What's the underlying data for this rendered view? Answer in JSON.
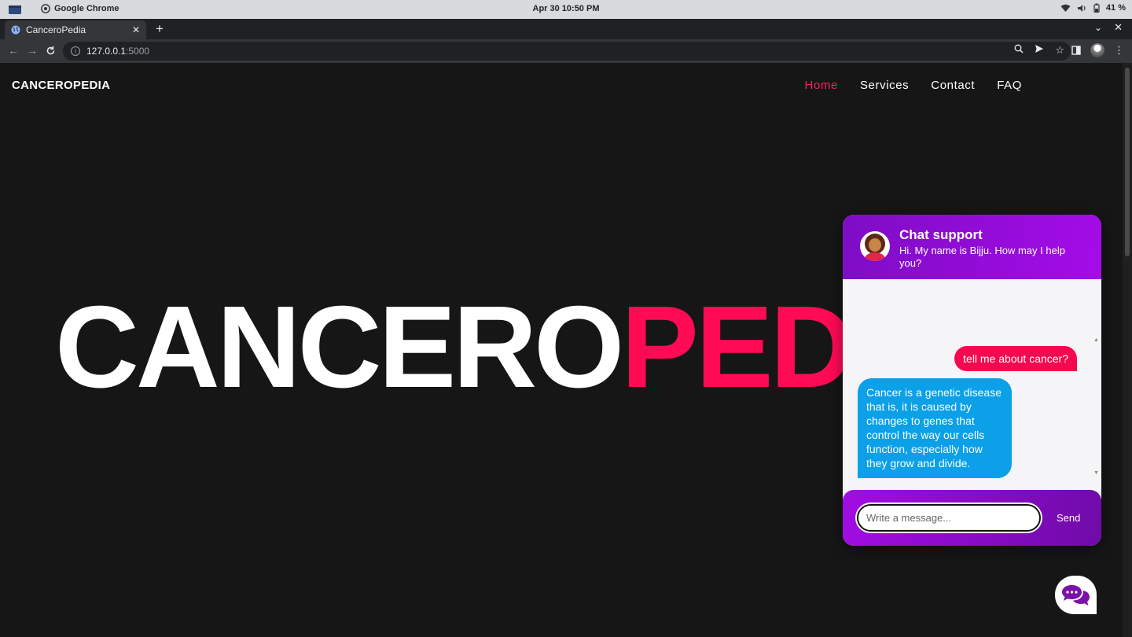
{
  "os": {
    "app_name": "Google Chrome",
    "clock": "Apr 30  10:50 PM",
    "battery": "41 %"
  },
  "browser": {
    "tab_title": "CanceroPedia",
    "url_host": "127.0.0.1",
    "url_port": ":5000"
  },
  "site": {
    "brand": "CANCEROPEDIA",
    "nav": [
      "Home",
      "Services",
      "Contact",
      "FAQ"
    ],
    "active_nav": "Home",
    "hero_white": "CANCERO",
    "hero_pink": "PEDIA"
  },
  "chat": {
    "title": "Chat support",
    "subtitle": "Hi. My name is Bijju. How may I help you?",
    "messages": [
      {
        "from": "user",
        "text": "tell me about cancer?"
      },
      {
        "from": "bot",
        "text": "Cancer is a genetic disease that is, it is caused by changes to genes that control the way our cells function, especially how they grow and divide."
      }
    ],
    "input_placeholder": "Write a message...",
    "send_label": "Send"
  },
  "colors": {
    "accent_pink": "#ff0a54",
    "chat_purple": "#a40ce8",
    "bot_bubble": "#0ba0e8"
  }
}
